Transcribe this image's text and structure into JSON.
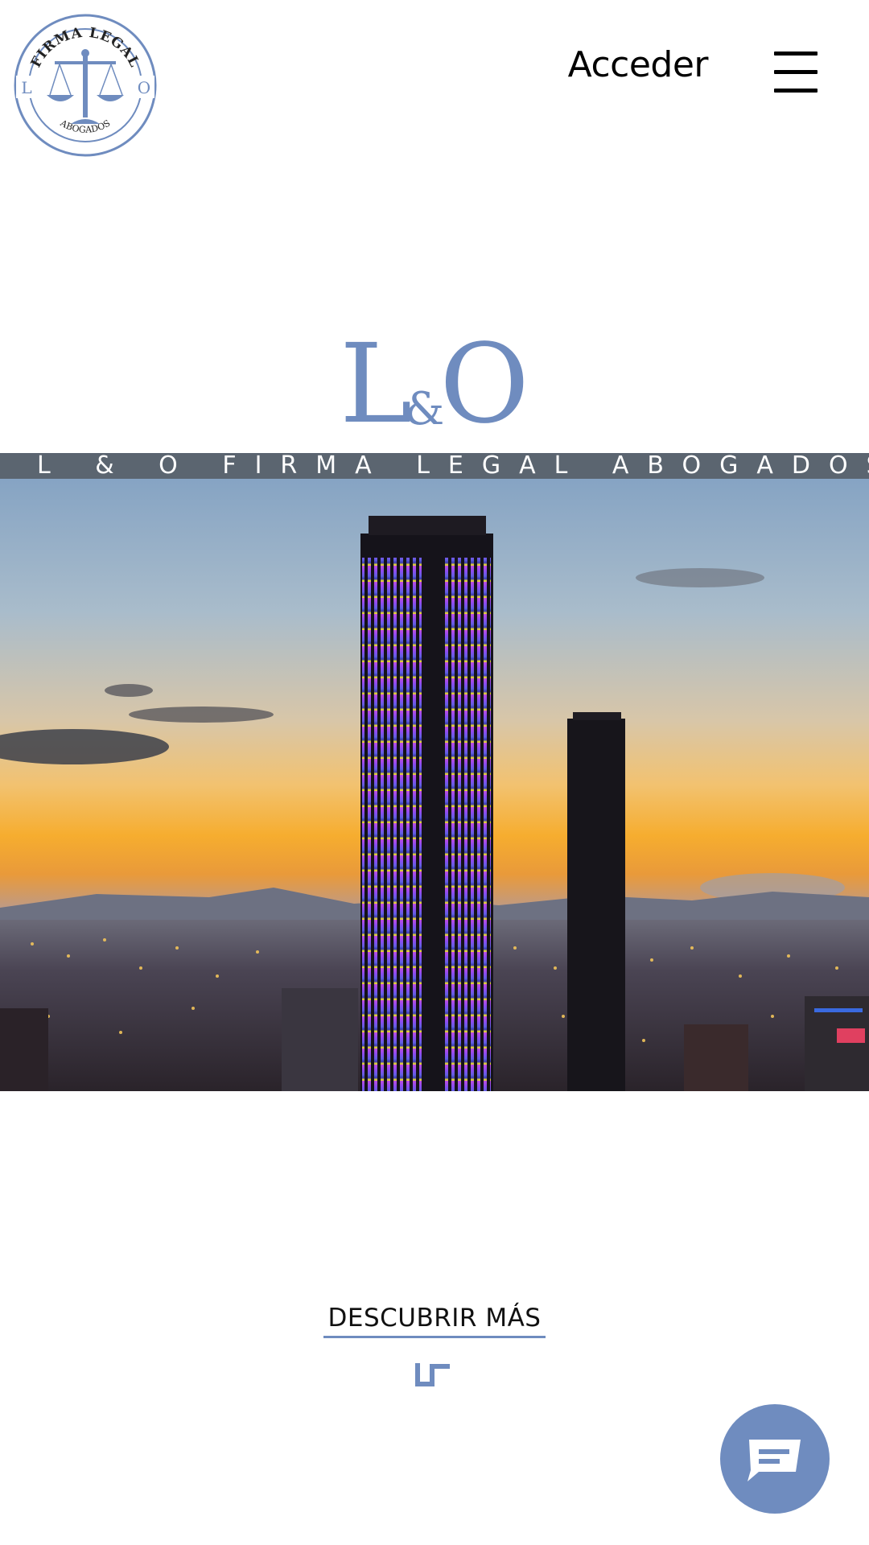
{
  "header": {
    "logo_top_text": "FIRMA LEGAL",
    "logo_bottom_text": "ABOGADOS",
    "logo_left_letter": "L",
    "logo_right_letter": "O",
    "login_label": "Acceder",
    "menu_icon": "hamburger-menu-icon"
  },
  "brand": {
    "mark_left": "L",
    "mark_amp": "&",
    "mark_right": "O",
    "tagline": "L & O FIRMA LEGAL ABOGADOS"
  },
  "hero": {
    "image": "city-skyline-sunset-photo"
  },
  "cta": {
    "label": "DESCUBRIR MÁS",
    "arrow_icon": "arrow-down-icon"
  },
  "chat": {
    "icon": "chat-bubble-icon"
  },
  "colors": {
    "accent": "#6f8cbf",
    "banner": "#555c64",
    "text": "#000000"
  }
}
